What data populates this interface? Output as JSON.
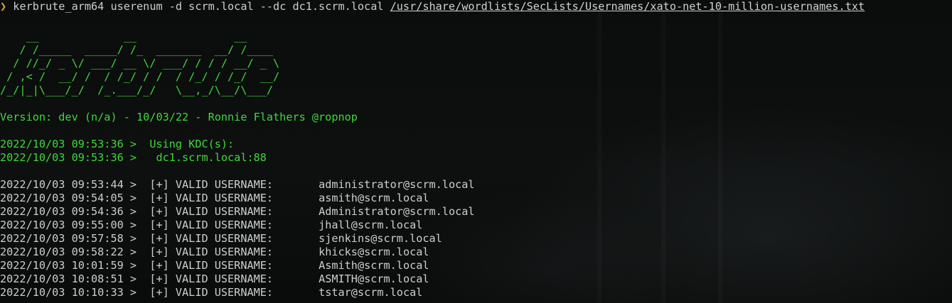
{
  "prompt": {
    "symbol": "❯",
    "command": " kerbrute_arm64 userenum -d scrm.local --dc dc1.scrm.local ",
    "wordlist": "/usr/share/wordlists/SecLists/Usernames/xato-net-10-million-usernames.txt"
  },
  "banner": [
    "    __             __               __     ",
    "   / /_____  _____/ /_  _______  __/ /____ ",
    "  / //_/ _ \\/ ___/ __ \\/ ___/ / / / __/ _ \\",
    " / ,< /  __/ /  / /_/ / /  / /_/ / /_/  __/",
    "/_/|_|\\___/_/  /_.___/_/   \\__,_/\\__/\\___/ "
  ],
  "version": "Version: dev (n/a) - 10/03/22 - Ronnie Flathers @ropnop",
  "kdc": [
    {
      "time": "2022/10/03 09:53:36 >",
      "text": "  Using KDC(s):"
    },
    {
      "time": "2022/10/03 09:53:36 >",
      "text": "   dc1.scrm.local:88"
    }
  ],
  "results": [
    {
      "time": "2022/10/03 09:53:44 >",
      "label": "  [+] VALID USERNAME:",
      "user": "administrator@scrm.local"
    },
    {
      "time": "2022/10/03 09:54:05 >",
      "label": "  [+] VALID USERNAME:",
      "user": "asmith@scrm.local"
    },
    {
      "time": "2022/10/03 09:54:36 >",
      "label": "  [+] VALID USERNAME:",
      "user": "Administrator@scrm.local"
    },
    {
      "time": "2022/10/03 09:55:00 >",
      "label": "  [+] VALID USERNAME:",
      "user": "jhall@scrm.local"
    },
    {
      "time": "2022/10/03 09:57:58 >",
      "label": "  [+] VALID USERNAME:",
      "user": "sjenkins@scrm.local"
    },
    {
      "time": "2022/10/03 09:58:22 >",
      "label": "  [+] VALID USERNAME:",
      "user": "khicks@scrm.local"
    },
    {
      "time": "2022/10/03 10:01:59 >",
      "label": "  [+] VALID USERNAME:",
      "user": "Asmith@scrm.local"
    },
    {
      "time": "2022/10/03 10:08:51 >",
      "label": "  [+] VALID USERNAME:",
      "user": "ASMITH@scrm.local"
    },
    {
      "time": "2022/10/03 10:10:33 >",
      "label": "  [+] VALID USERNAME:",
      "user": "tstar@scrm.local"
    }
  ],
  "colors": {
    "background": "#0a0b0b",
    "text": "#c9d0cc",
    "accent_green": "#3fd83a",
    "prompt_symbol": "#d4a83a"
  }
}
